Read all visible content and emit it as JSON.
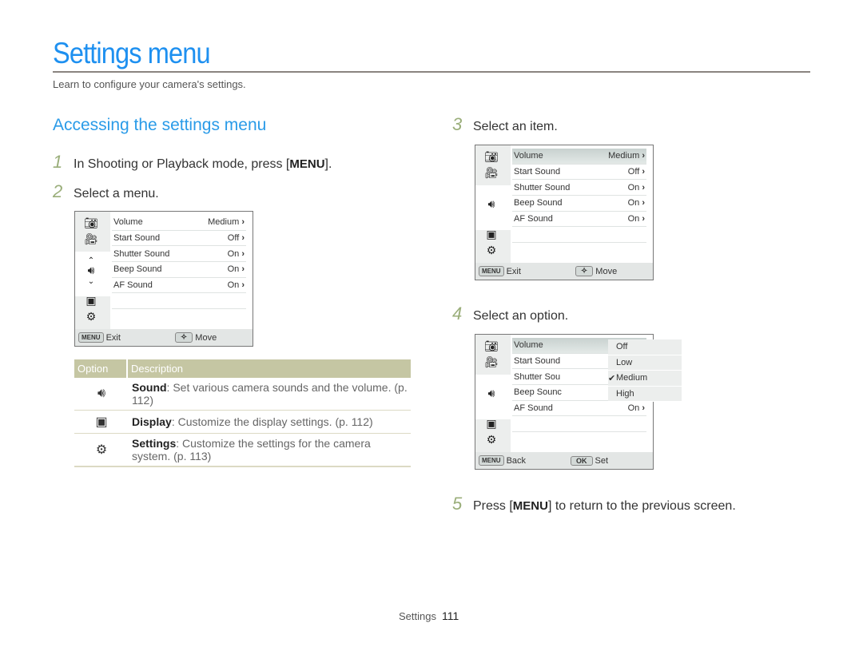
{
  "header": {
    "title": "Settings menu",
    "subtitle": "Learn to configure your camera's settings."
  },
  "section": {
    "heading": "Accessing the settings menu"
  },
  "steps": [
    {
      "num": "1",
      "pre": "In Shooting or Playback mode, press [",
      "key": "MENU",
      "post": "]."
    },
    {
      "num": "2",
      "text": "Select a menu."
    },
    {
      "num": "3",
      "text": "Select an item."
    },
    {
      "num": "4",
      "text": "Select an option."
    },
    {
      "num": "5",
      "pre": "Press [",
      "key": "MENU",
      "post": "] to return to the previous screen."
    }
  ],
  "camera_menu": {
    "side_icons": [
      "camera-icon",
      "video-camera-icon",
      "sound-icon",
      "display-icon",
      "gear-icon"
    ],
    "rows": [
      {
        "label": "Volume",
        "value": "Medium"
      },
      {
        "label": "Start Sound",
        "value": "Off"
      },
      {
        "label": "Shutter Sound",
        "value": "On"
      },
      {
        "label": "Beep Sound",
        "value": "On"
      },
      {
        "label": "AF Sound",
        "value": "On"
      }
    ],
    "footer": {
      "menu_key": "MENU",
      "exit": "Exit",
      "move": "Move",
      "back": "Back",
      "ok_key": "OK",
      "set": "Set"
    }
  },
  "option_screen": {
    "truncated_rows": [
      "Volume",
      "Start Sound",
      "Shutter Sou",
      "Beep Sounc",
      "AF Sound"
    ],
    "af_value": "On",
    "options": [
      "Off",
      "Low",
      "Medium",
      "High"
    ],
    "selected": "Medium"
  },
  "table": {
    "headers": [
      "Option",
      "Description"
    ],
    "rows": [
      {
        "icon": "sound-icon",
        "name": "Sound",
        "desc": ": Set various camera sounds and the volume. (p. 112)"
      },
      {
        "icon": "display-icon",
        "name": "Display",
        "desc": ": Customize the display settings. (p. 112)"
      },
      {
        "icon": "gear-icon",
        "name": "Settings",
        "desc": ": Customize the settings for the camera system. (p. 113)"
      }
    ]
  },
  "footer": {
    "section": "Settings",
    "page": "111"
  }
}
